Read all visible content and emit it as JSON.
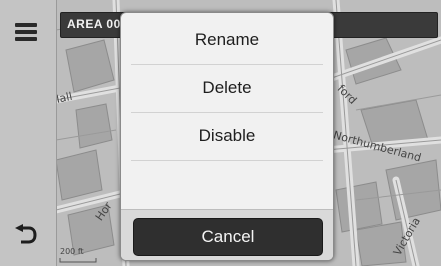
{
  "header": {
    "area_label": "AREA 00"
  },
  "rail": {
    "menu_icon": "menu-icon",
    "back_icon": "back-arrow-icon"
  },
  "map": {
    "street_labels": [
      "Mall",
      "Hor",
      "Victoria",
      "Northumberland",
      "ford",
      "200 ft"
    ]
  },
  "dialog": {
    "options": [
      "Rename",
      "Delete",
      "Disable"
    ],
    "cancel_label": "Cancel"
  }
}
